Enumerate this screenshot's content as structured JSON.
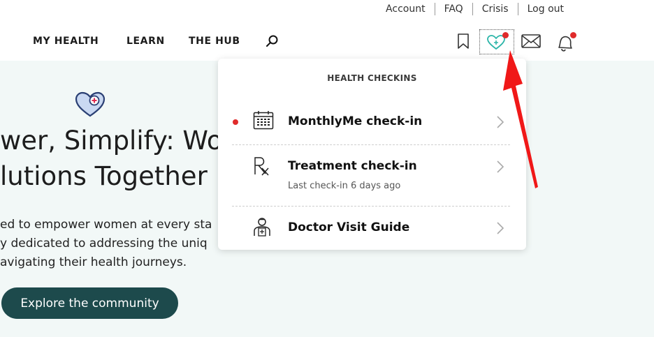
{
  "utility_links": [
    "Account",
    "FAQ",
    "Crisis",
    "Log out"
  ],
  "nav": {
    "items": [
      "MY HEALTH",
      "LEARN",
      "THE HUB"
    ],
    "icons": [
      "search-icon",
      "bookmark-icon",
      "heart-plus-icon",
      "mail-icon",
      "bell-icon"
    ]
  },
  "hero": {
    "title": "wer, Simplify: Wo\nlutions Together",
    "body": "ed to empower women at every sta\ny dedicated to addressing the uniq\navigating their health journeys.",
    "button": "Explore the community"
  },
  "dropdown": {
    "title": "HEALTH CHECKINS",
    "items": [
      {
        "label": "MonthlyMe check-in",
        "icon": "calendar-icon",
        "new": true
      },
      {
        "label": "Treatment check-in",
        "sub": "Last check-in 6 days ago",
        "icon": "rx-icon"
      },
      {
        "label": "Doctor Visit Guide",
        "icon": "doctor-icon"
      }
    ]
  },
  "colors": {
    "accent": "#1d4a4c",
    "alert": "#e02b2b",
    "hero_bg": "#f2f8f7",
    "teal_icon": "#2bb5a8"
  }
}
